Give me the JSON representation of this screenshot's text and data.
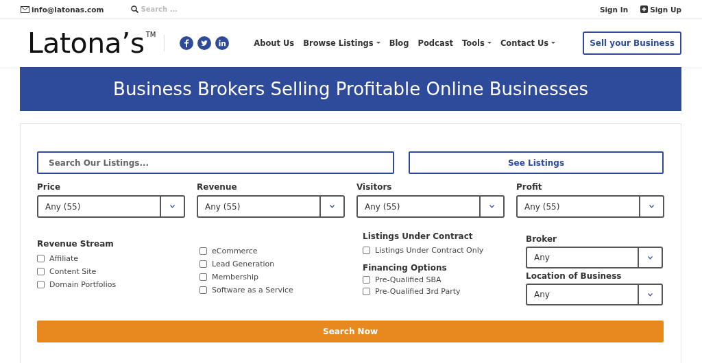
{
  "top_bar": {
    "email": "info@latonas.com",
    "search": {
      "placeholder": "Search ..."
    },
    "sign_in": "Sign In",
    "sign_up": "Sign Up"
  },
  "header": {
    "logo": "Latona’s",
    "trademark": "TM",
    "social": [
      {
        "kind": "facebook"
      },
      {
        "kind": "twitter"
      },
      {
        "kind": "linkedin"
      }
    ],
    "nav": [
      {
        "label": "About Us",
        "has_menu": false
      },
      {
        "label": "Browse Listings",
        "has_menu": true
      },
      {
        "label": "Blog",
        "has_menu": false
      },
      {
        "label": "Podcast",
        "has_menu": false
      },
      {
        "label": "Tools",
        "has_menu": true
      },
      {
        "label": "Contact Us",
        "has_menu": true
      }
    ],
    "cta": "Sell your Business"
  },
  "banner": "Business Brokers Selling Profitable Online Businesses",
  "form": {
    "search": {
      "placeholder": "Search Our Listings..."
    },
    "see_listings": "See Listings",
    "selects": [
      {
        "label": "Price",
        "value": "Any (55)"
      },
      {
        "label": "Revenue",
        "value": "Any (55)"
      },
      {
        "label": "Visitors",
        "value": "Any (55)"
      },
      {
        "label": "Profit",
        "value": "Any (55)"
      }
    ],
    "revenue_stream": {
      "title": "Revenue Stream",
      "options": [
        {
          "label": "Affiliate",
          "checked": false
        },
        {
          "label": "Content Site",
          "checked": false
        },
        {
          "label": "Domain Portfolios",
          "checked": false
        },
        {
          "label": "eCommerce",
          "checked": false
        },
        {
          "label": "Lead Generation",
          "checked": false
        },
        {
          "label": "Membership",
          "checked": false
        },
        {
          "label": "Software as a Service",
          "checked": false
        }
      ]
    },
    "under_contract": {
      "title": "Listings Under Contract",
      "options": [
        {
          "label": "Listings Under Contract Only",
          "checked": false
        }
      ]
    },
    "financing": {
      "title": "Financing Options",
      "options": [
        {
          "label": "Pre-Qualified SBA",
          "checked": false
        },
        {
          "label": "Pre-Qualified 3rd Party",
          "checked": false
        }
      ]
    },
    "broker": {
      "label": "Broker",
      "value": "Any"
    },
    "location": {
      "label": "Location of Business",
      "value": "Any"
    },
    "submit": "Search Now"
  }
}
